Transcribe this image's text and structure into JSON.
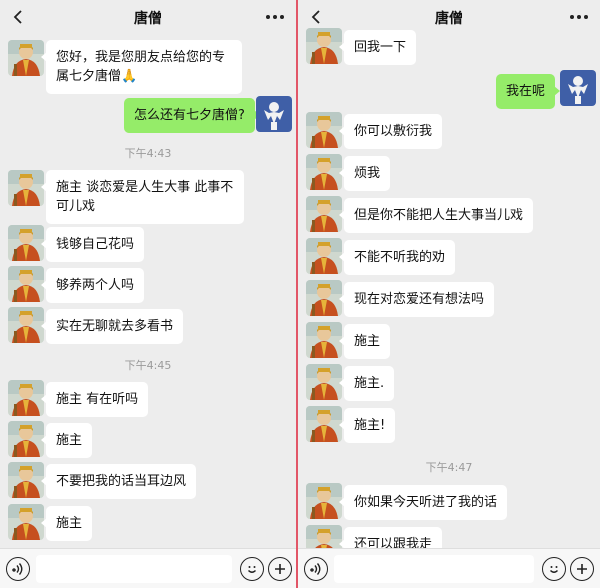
{
  "colors": {
    "accent_divider": "#e25667",
    "outgoing_bubble": "#95ec69",
    "background": "#ededed"
  },
  "left": {
    "header": {
      "title": "唐僧",
      "back_icon": "chevron-left-icon",
      "more_icon": "more-dots-icon"
    },
    "messages": [
      {
        "type": "in",
        "text": "您好，我是您朋友点给您的专属七夕唐僧🙏"
      },
      {
        "type": "out",
        "text": "怎么还有七夕唐僧?"
      },
      {
        "type": "time",
        "text": "下午4:43"
      },
      {
        "type": "in",
        "text": "施主 谈恋爱是人生大事 此事不可儿戏"
      },
      {
        "type": "in",
        "text": "钱够自己花吗"
      },
      {
        "type": "in",
        "text": "够养两个人吗"
      },
      {
        "type": "in",
        "text": "实在无聊就去多看书"
      },
      {
        "type": "time",
        "text": "下午4:45"
      },
      {
        "type": "in",
        "text": "施主 有在听吗"
      },
      {
        "type": "in",
        "text": "施主"
      },
      {
        "type": "in",
        "text": "不要把我的话当耳边风"
      },
      {
        "type": "in",
        "text": "施主"
      }
    ],
    "input_bar": {
      "voice_icon": "voice-icon",
      "emoji_icon": "emoji-icon",
      "plus_icon": "plus-icon"
    }
  },
  "right": {
    "header": {
      "title": "唐僧",
      "back_icon": "chevron-left-icon",
      "more_icon": "more-dots-icon"
    },
    "messages": [
      {
        "type": "in",
        "text": "回我一下"
      },
      {
        "type": "out",
        "text": "我在呢"
      },
      {
        "type": "in",
        "text": "你可以敷衍我"
      },
      {
        "type": "in",
        "text": "烦我"
      },
      {
        "type": "in",
        "text": "但是你不能把人生大事当儿戏"
      },
      {
        "type": "in",
        "text": "不能不听我的劝"
      },
      {
        "type": "in",
        "text": "现在对恋爱还有想法吗"
      },
      {
        "type": "in",
        "text": "施主"
      },
      {
        "type": "in",
        "text": "施主."
      },
      {
        "type": "in",
        "text": "施主!"
      },
      {
        "type": "time",
        "text": "下午4:47"
      },
      {
        "type": "in",
        "text": "你如果今天听进了我的话"
      },
      {
        "type": "in",
        "text": "还可以跟我走"
      }
    ],
    "input_bar": {
      "voice_icon": "voice-icon",
      "emoji_icon": "emoji-icon",
      "plus_icon": "plus-icon"
    }
  }
}
